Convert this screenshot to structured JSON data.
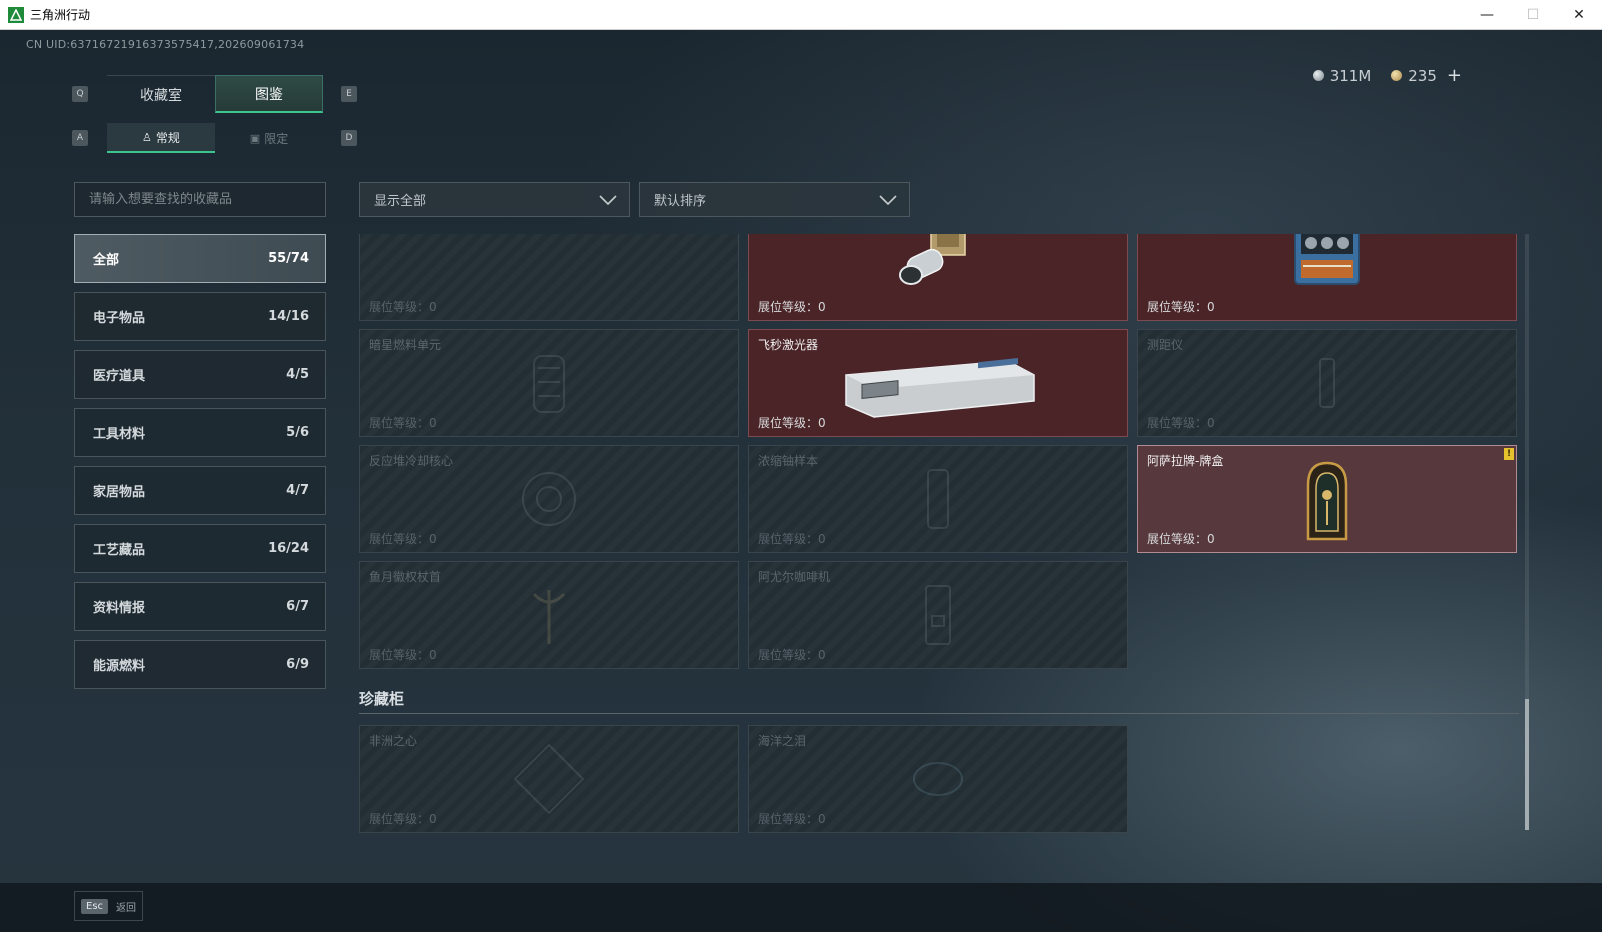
{
  "window": {
    "title": "三角洲行动",
    "minimize": "—",
    "maximize": "☐",
    "close": "✕"
  },
  "header": {
    "uid": "CN UID:63716721916373575417,202609061734",
    "currency": [
      {
        "icon": "silver-coin-icon",
        "value": "311M"
      },
      {
        "icon": "gold-coin-icon",
        "value": "235"
      }
    ],
    "add": "+"
  },
  "keys": {
    "prev_tab": "Q",
    "next_tab": "E",
    "prev_sub": "A",
    "next_sub": "D"
  },
  "tabs": [
    {
      "label": "收藏室",
      "active": false
    },
    {
      "label": "图鉴",
      "active": true
    }
  ],
  "sub_tabs": [
    {
      "label": "常规",
      "icon": "figure-icon",
      "active": true
    },
    {
      "label": "限定",
      "icon": "image-icon",
      "active": false
    }
  ],
  "search": {
    "placeholder": "请输入想要查找的收藏品"
  },
  "filters": {
    "show": "显示全部",
    "sort": "默认排序"
  },
  "categories": [
    {
      "label": "全部",
      "count": "55/74",
      "active": true
    },
    {
      "label": "电子物品",
      "count": "14/16"
    },
    {
      "label": "医疗道具",
      "count": "4/5"
    },
    {
      "label": "工具材料",
      "count": "5/6"
    },
    {
      "label": "家居物品",
      "count": "4/7"
    },
    {
      "label": "工艺藏品",
      "count": "16/24"
    },
    {
      "label": "资料情报",
      "count": "6/7"
    },
    {
      "label": "能源燃料",
      "count": "6/9"
    }
  ],
  "level_label": "展位等级：0",
  "cards": [
    {
      "name": "",
      "owned": false
    },
    {
      "name": "",
      "owned": true
    },
    {
      "name": "",
      "owned": true
    },
    {
      "name": "暗星燃料单元",
      "owned": false
    },
    {
      "name": "飞秒激光器",
      "owned": true
    },
    {
      "name": "测距仪",
      "owned": false
    },
    {
      "name": "反应堆冷却核心",
      "owned": false
    },
    {
      "name": "浓缩铀样本",
      "owned": false
    },
    {
      "name": "阿萨拉牌-牌盒",
      "owned": true,
      "badge": "!"
    },
    {
      "name": "鱼月徽权杖首",
      "owned": false
    },
    {
      "name": "阿尤尔咖啡机",
      "owned": false
    }
  ],
  "cabinet": {
    "title": "珍藏柜",
    "cards": [
      {
        "name": "非洲之心",
        "owned": false
      },
      {
        "name": "海洋之泪",
        "owned": false
      }
    ]
  },
  "footer": {
    "key": "Esc",
    "label": "返回"
  },
  "colors": {
    "accent": "#3cc48f",
    "owned_card": "#4b2428",
    "badge": "#e4c12d"
  }
}
